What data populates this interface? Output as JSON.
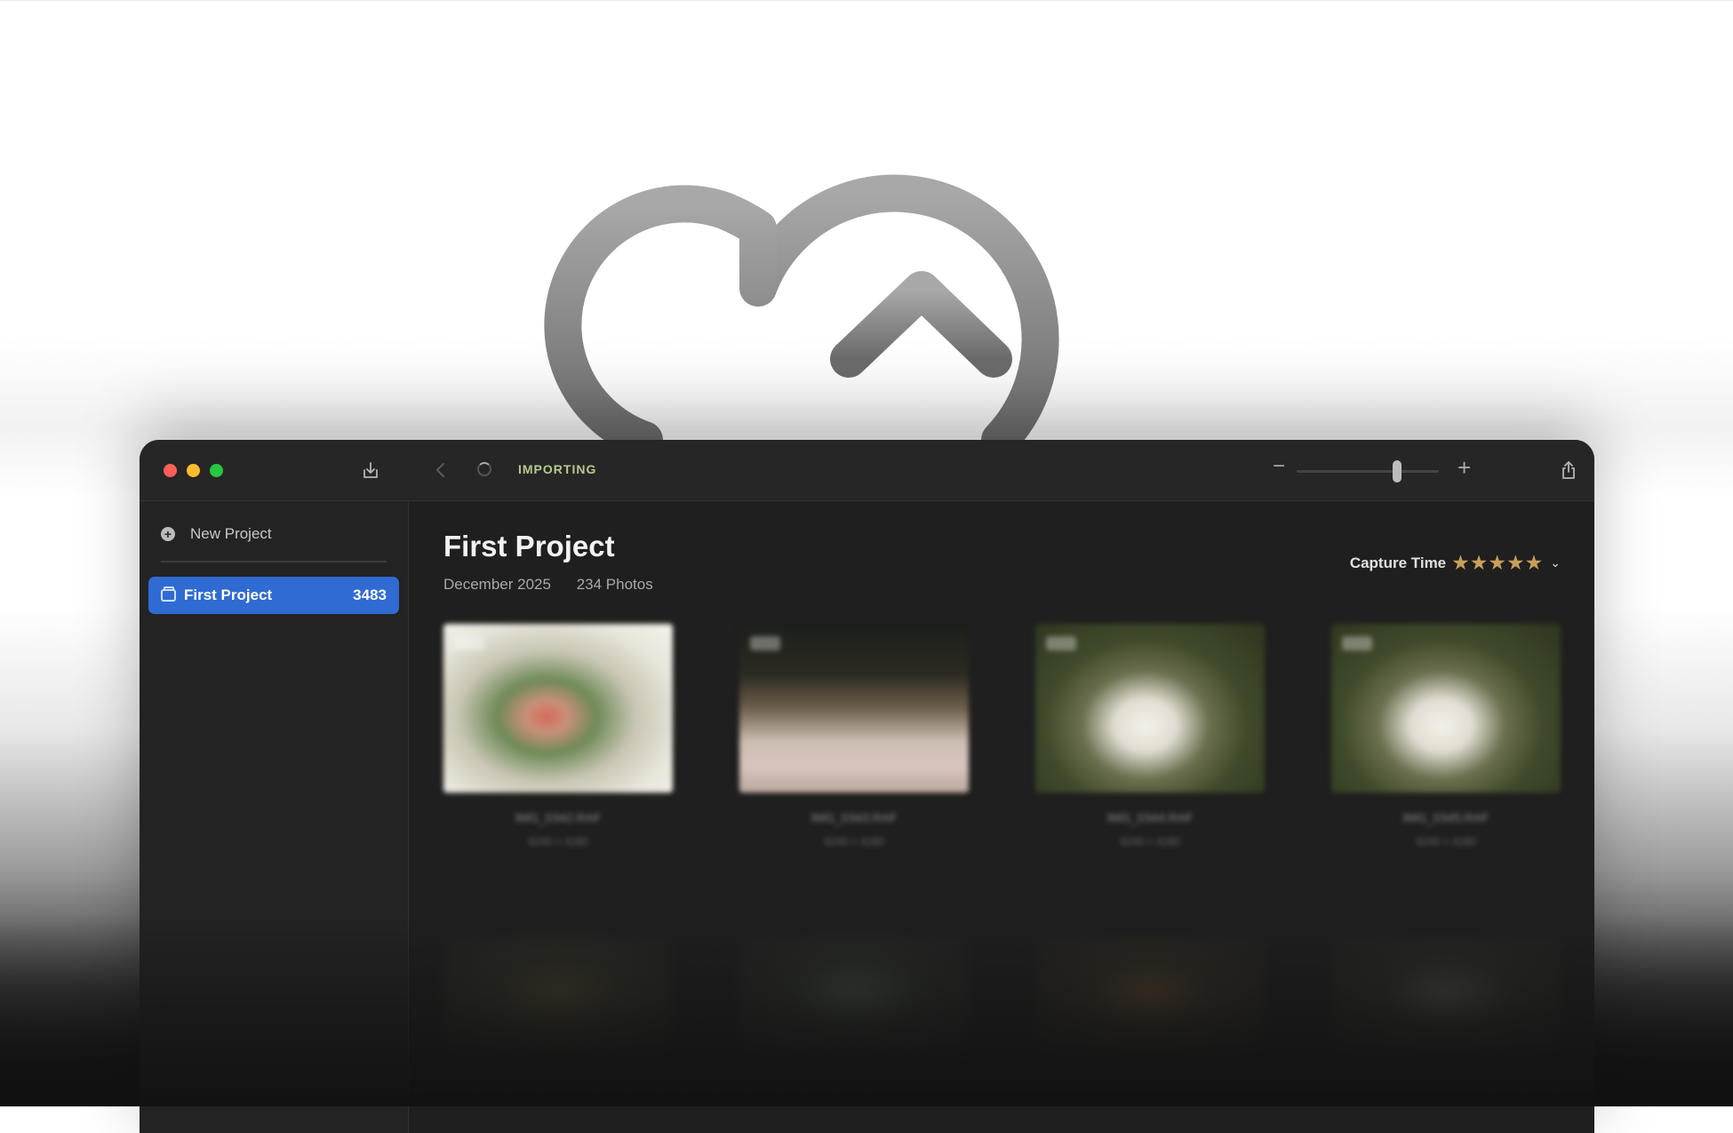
{
  "hero": {
    "icon": "cloud-upload-icon"
  },
  "titlebar": {
    "status": "IMPORTING",
    "zoom": {
      "minus": "−",
      "plus": "+",
      "level": 0.72
    }
  },
  "sidebar": {
    "new_project_label": "New Project",
    "projects": [
      {
        "name": "First Project",
        "count": "3483",
        "selected": true
      }
    ]
  },
  "main": {
    "title": "First Project",
    "date": "December 2025",
    "photo_count": "234 Photos",
    "sort": {
      "label": "Capture Time",
      "rating": 5,
      "star": "★",
      "chevron": "⌄"
    },
    "photos": [
      {
        "filename": "IMG_0342.RAF",
        "dims": "6240 × 4160",
        "badge": "RAW"
      },
      {
        "filename": "IMG_0343.RAF",
        "dims": "6240 × 4160",
        "badge": "RAW"
      },
      {
        "filename": "IMG_0344.RAF",
        "dims": "6240 × 4160",
        "badge": "RAW"
      },
      {
        "filename": "IMG_0345.RAF",
        "dims": "6240 × 4160",
        "badge": "RAW"
      }
    ]
  },
  "colors": {
    "accent": "#2f6bd3",
    "status": "#b7c98e",
    "star": "#c9a05a"
  }
}
